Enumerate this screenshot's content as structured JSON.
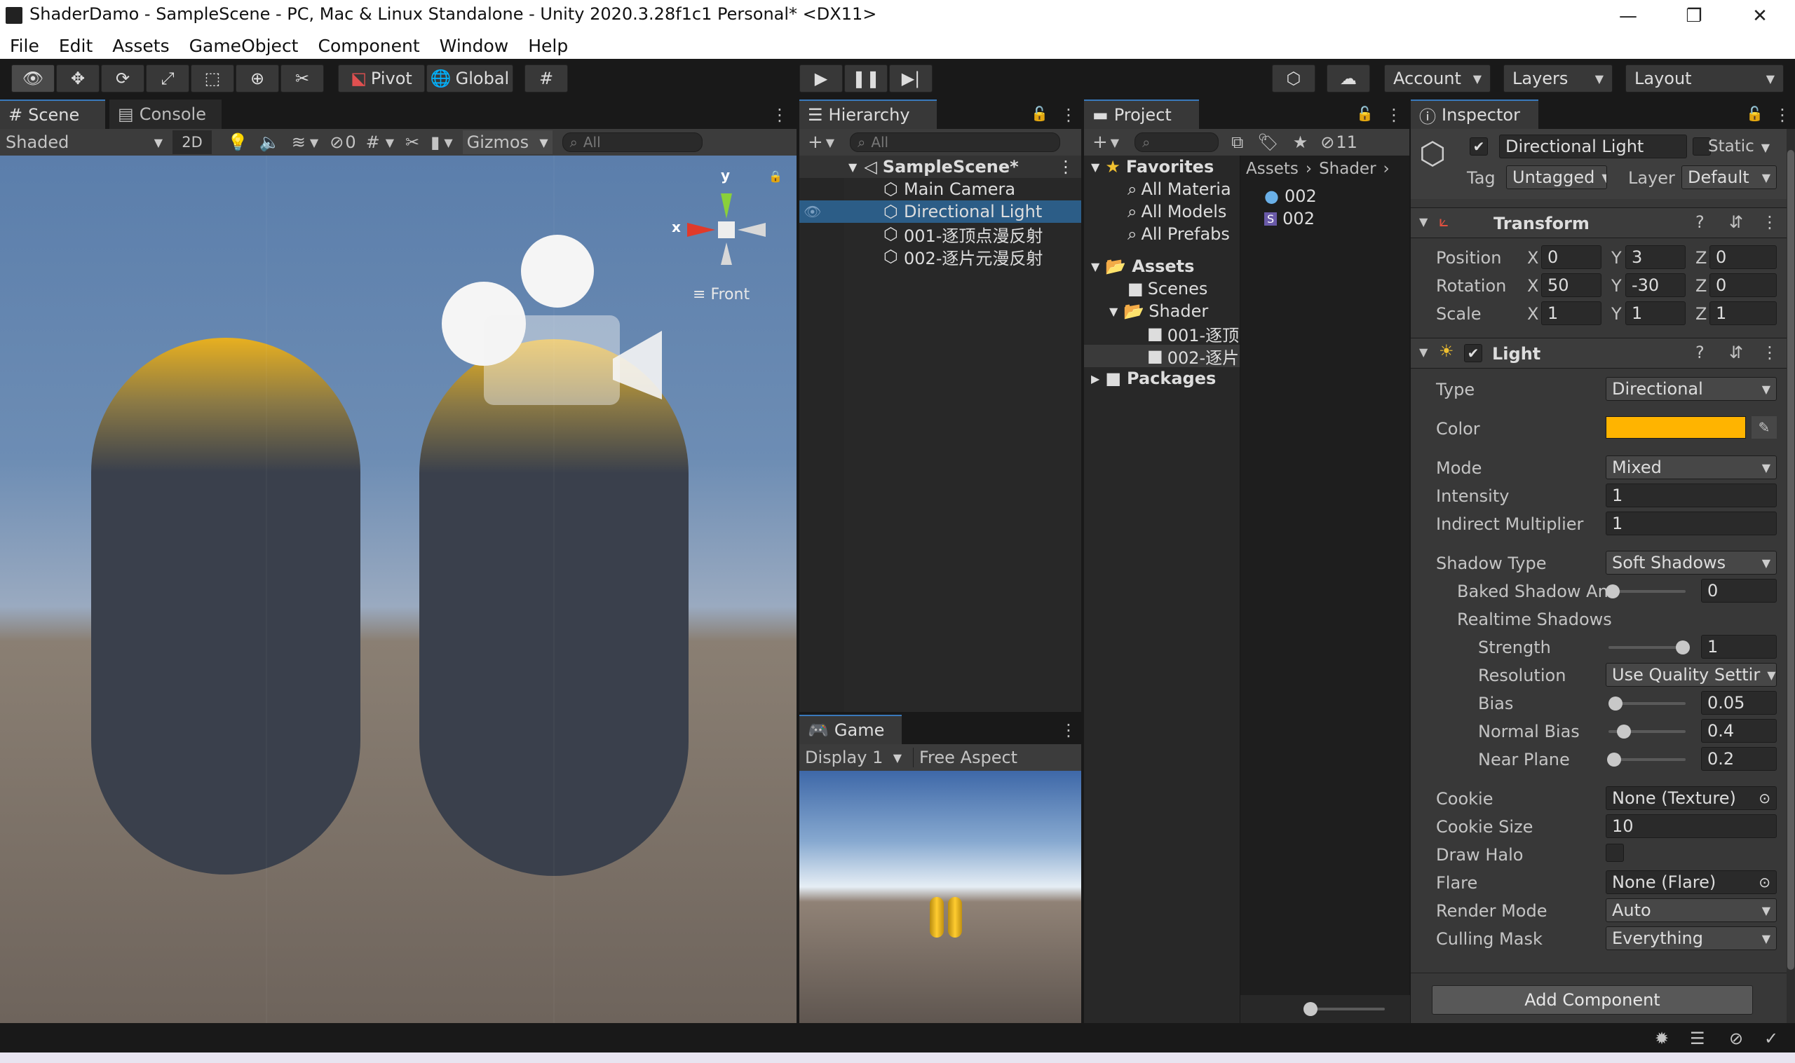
{
  "window": {
    "title": "ShaderDamo - SampleScene - PC, Mac & Linux Standalone - Unity 2020.3.28f1c1 Personal* <DX11>",
    "minimize": "—",
    "maximize": "❐",
    "close": "✕"
  },
  "menu": [
    "File",
    "Edit",
    "Assets",
    "GameObject",
    "Component",
    "Window",
    "Help"
  ],
  "toolbar": {
    "pivot": "Pivot",
    "global": "Global",
    "account": "Account",
    "layers": "Layers",
    "layout": "Layout"
  },
  "scene": {
    "tab_scene": "Scene",
    "tab_console": "Console",
    "shading": "Shaded",
    "mode_2d": "2D",
    "hidden_count": "0",
    "gizmos": "Gizmos",
    "search_placeholder": "All",
    "axis_x": "x",
    "axis_y": "y",
    "view_label": "Front"
  },
  "hierarchy": {
    "tab": "Hierarchy",
    "search_placeholder": "All",
    "scene": "SampleScene*",
    "items": [
      "Main Camera",
      "Directional Light",
      "001-逐顶点漫反射",
      "002-逐片元漫反射"
    ]
  },
  "game": {
    "tab": "Game",
    "display": "Display 1",
    "aspect": "Free Aspect"
  },
  "project": {
    "tab": "Project",
    "hidden_count": "11",
    "favorites": "Favorites",
    "fav_items": [
      "All Materia",
      "All Models",
      "All Prefabs"
    ],
    "assets": "Assets",
    "asset_items": [
      "Scenes",
      "Shader"
    ],
    "shader_items": [
      "001-逐顶",
      "002-逐片"
    ],
    "packages": "Packages",
    "breadcrumb": [
      "Assets",
      "Shader"
    ],
    "files": [
      "002",
      "002"
    ]
  },
  "inspector": {
    "tab": "Inspector",
    "object_name": "Directional Light",
    "static_label": "Static",
    "tag_label": "Tag",
    "tag_value": "Untagged",
    "layer_label": "Layer",
    "layer_value": "Default",
    "transform": {
      "title": "Transform",
      "position_label": "Position",
      "rotation_label": "Rotation",
      "scale_label": "Scale",
      "position": [
        "0",
        "3",
        "0"
      ],
      "rotation": [
        "50",
        "-30",
        "0"
      ],
      "scale": [
        "1",
        "1",
        "1"
      ]
    },
    "light": {
      "title": "Light",
      "type_label": "Type",
      "type": "Directional",
      "color_label": "Color",
      "color": "#ffb400",
      "mode_label": "Mode",
      "mode": "Mixed",
      "intensity_label": "Intensity",
      "intensity": "1",
      "indirect_label": "Indirect Multiplier",
      "indirect": "1",
      "shadow_type_label": "Shadow Type",
      "shadow_type": "Soft Shadows",
      "baked_label": "Baked Shadow An",
      "baked": "0",
      "realtime_label": "Realtime Shadows",
      "strength_label": "Strength",
      "strength": "1",
      "resolution_label": "Resolution",
      "resolution": "Use Quality Settir",
      "bias_label": "Bias",
      "bias": "0.05",
      "normal_bias_label": "Normal Bias",
      "normal_bias": "0.4",
      "near_plane_label": "Near Plane",
      "near_plane": "0.2",
      "cookie_label": "Cookie",
      "cookie": "None (Texture)",
      "cookie_size_label": "Cookie Size",
      "cookie_size": "10",
      "draw_halo_label": "Draw Halo",
      "flare_label": "Flare",
      "flare": "None (Flare)",
      "render_mode_label": "Render Mode",
      "render_mode": "Auto",
      "culling_label": "Culling Mask",
      "culling": "Everything"
    },
    "add_component": "Add Component"
  }
}
